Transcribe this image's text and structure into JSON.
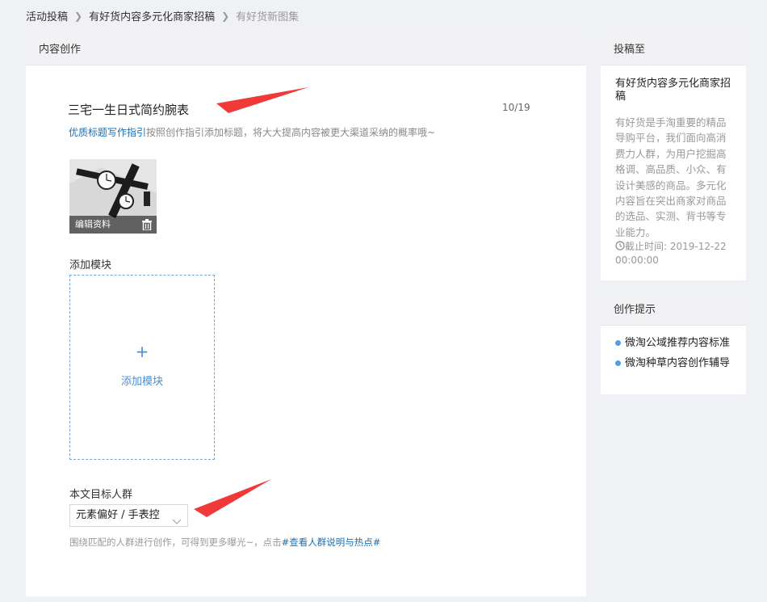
{
  "breadcrumb": {
    "items": [
      "活动投稿",
      "有好货内容多元化商家招稿",
      "有好货新图集"
    ]
  },
  "main": {
    "header": "内容创作",
    "title_value": "三宅一生日式简约腕表",
    "title_counter": "10/19",
    "guide_link": "优质标题写作指引",
    "guide_text": "按照创作指引添加标题，将大大提高内容被更大渠道采纳的概率哦~",
    "thumb_label": "编辑资料",
    "module_label": "添加模块",
    "add_plus": "+",
    "add_text": "添加模块",
    "audience_label": "本文目标人群",
    "audience_value": "元素偏好 / 手表控",
    "audience_hint": "围绕匹配的人群进行创作，可得到更多曝光~，点击",
    "audience_link": "#查看人群说明与热点#"
  },
  "sidebar": {
    "submit_header": "投稿至",
    "campaign_name": "有好货内容多元化商家招稿",
    "campaign_desc": "有好货是手淘重要的精品导购平台，我们面向高消费力人群，为用户挖掘高格调、高品质、小众、有设计美感的商品。多元化内容旨在突出商家对商品的选品、实测、背书等专业能力。",
    "deadline": "截止时间: 2019-12-22 00:00:00",
    "tips_header": "创作提示",
    "tips": [
      "微淘公域推荐内容标准",
      "微淘种草内容创作辅导"
    ]
  },
  "colors": {
    "link": "#1a6fb0",
    "accent": "#4a8fd3",
    "annotation_arrow": "#f03a3a",
    "tip_dot": "#5b9be0"
  }
}
